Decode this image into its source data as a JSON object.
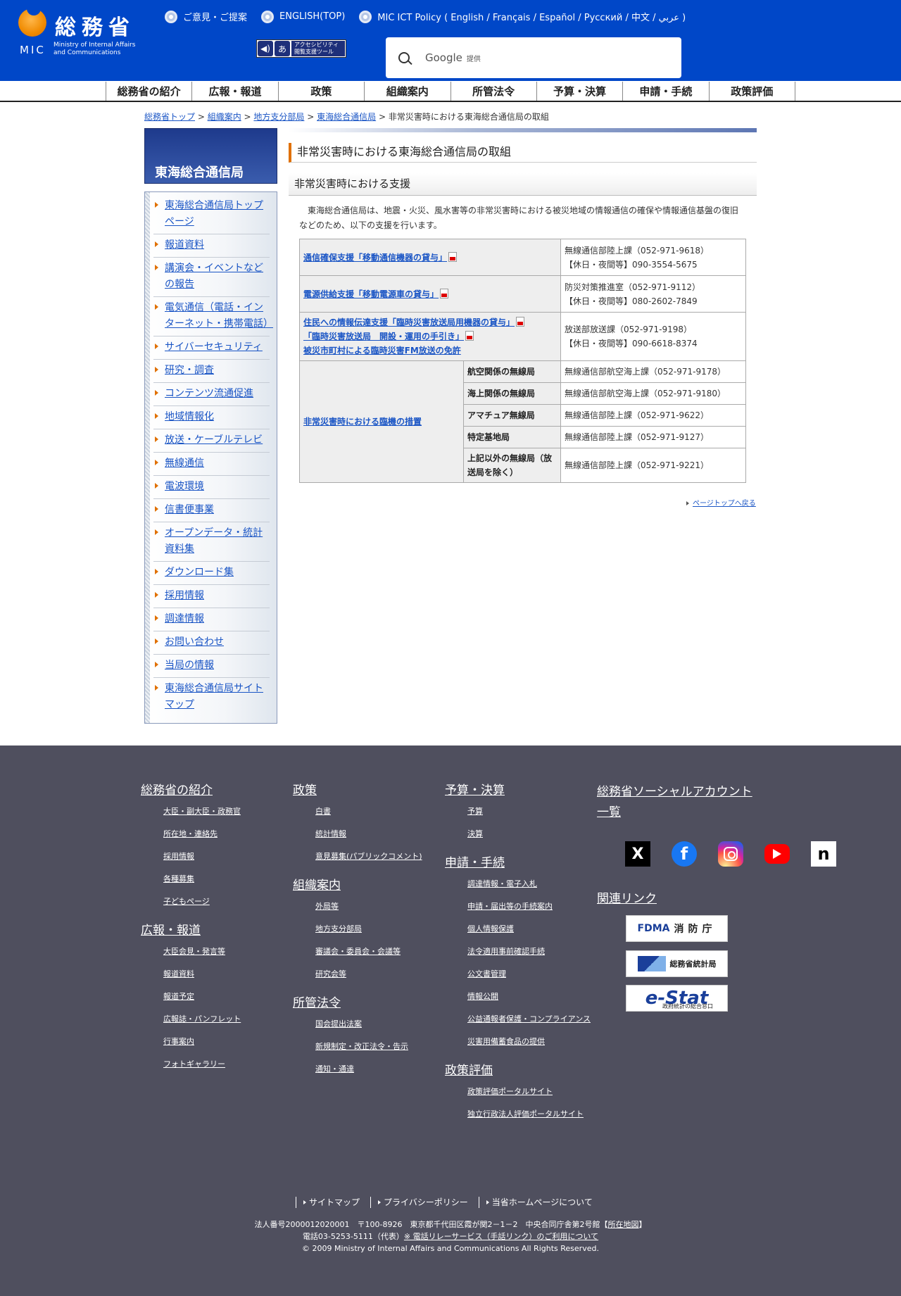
{
  "header": {
    "logo_jp": "総務省",
    "logo_mic": "MIC",
    "logo_en_1": "Ministry of Internal Affairs",
    "logo_en_2": "and Communications",
    "top_links": [
      "ご意見・ご提案",
      "ENGLISH(TOP)",
      "MIC ICT Policy ( English / Français / Español / Русский / 中文 / عربي )"
    ],
    "accessibility_label": "アクセシビリティ 閲覧支援ツール",
    "search_google": "Google",
    "search_provided": "提供"
  },
  "nav": [
    "総務省の紹介",
    "広報・報道",
    "政策",
    "組織案内",
    "所管法令",
    "予算・決算",
    "申請・手続",
    "政策評価"
  ],
  "breadcrumb": {
    "items": [
      "総務省トップ",
      "組織案内",
      "地方支分部局",
      "東海総合通信局"
    ],
    "current": "非常災害時における東海総合通信局の取組"
  },
  "sidebar": {
    "title": "東海総合通信局",
    "items": [
      "東海総合通信局トップページ",
      "報道資料",
      "講演会・イベントなどの報告",
      "電気通信（電話・インターネット・携帯電話）",
      "サイバーセキュリティ",
      "研究・調査",
      "コンテンツ流通促進",
      "地域情報化",
      "放送・ケーブルテレビ",
      "無線通信",
      "電波環境",
      "信書便事業",
      "オープンデータ・統計資料集",
      "ダウンロード集",
      "採用情報",
      "調達情報",
      "お問い合わせ",
      "当局の情報",
      "東海総合通信局サイトマップ"
    ]
  },
  "main": {
    "title": "非常災害時における東海総合通信局の取組",
    "subtitle": "非常災害時における支援",
    "intro": "東海総合通信局は、地震・火災、風水害等の非常災害時における被災地域の情報通信の確保や情報通信基盤の復旧などのため、以下の支援を行います。",
    "rows": [
      {
        "link": "通信確保支援「移動通信機器の貸与」",
        "contact1": "無線通信部陸上課（052-971-9618）",
        "contact2": "【休日・夜間等】090-3554-5675"
      },
      {
        "link": "電源供給支援「移動電源車の貸与」",
        "contact1": "防災対策推進室（052-971-9112）",
        "contact2": "【休日・夜間等】080-2602-7849"
      },
      {
        "link1": "住民への情報伝達支援「臨時災害放送局用機器の貸与」",
        "link2": "「臨時災害放送局　開設・運用の手引き」",
        "link3": "被災市町村による臨時災害FM放送の免許",
        "contact1": "放送部放送課（052-971-9198）",
        "contact2": "【休日・夜間等】090-6618-8374"
      }
    ],
    "special_link": "非常災害時における臨機の措置",
    "special_rows": [
      {
        "type": "航空関係の無線局",
        "contact": "無線通信部航空海上課（052-971-9178）"
      },
      {
        "type": "海上関係の無線局",
        "contact": "無線通信部航空海上課（052-971-9180）"
      },
      {
        "type": "アマチュア無線局",
        "contact": "無線通信部陸上課（052-971-9622）"
      },
      {
        "type": "特定基地局",
        "contact": "無線通信部陸上課（052-971-9127）"
      },
      {
        "type": "上記以外の無線局（放送局を除く）",
        "contact": "無線通信部陸上課（052-971-9221）"
      }
    ],
    "pagetop": "ページトップへ戻る"
  },
  "footer": {
    "col1": [
      {
        "head": "総務省の紹介",
        "links": [
          "大臣・副大臣・政務官",
          "所在地・連絡先",
          "採用情報",
          "各種募集",
          "子どもページ"
        ]
      },
      {
        "head": "広報・報道",
        "links": [
          "大臣会見・発言等",
          "報道資料",
          "報道予定",
          "広報誌・パンフレット",
          "行事案内",
          "フォトギャラリー"
        ]
      }
    ],
    "col2": [
      {
        "head": "政策",
        "links": [
          "白書",
          "統計情報",
          "意見募集(パブリックコメント)"
        ]
      },
      {
        "head": "組織案内",
        "links": [
          "外局等",
          "地方支分部局",
          "審議会・委員会・会議等",
          "研究会等"
        ]
      },
      {
        "head": "所管法令",
        "links": [
          "国会提出法案",
          "新規制定・改正法令・告示",
          "通知・通達"
        ]
      }
    ],
    "col3": [
      {
        "head": "予算・決算",
        "links": [
          "予算",
          "決算"
        ]
      },
      {
        "head": "申請・手続",
        "links": [
          "調達情報・電子入札",
          "申請・届出等の手続案内",
          "個人情報保護",
          "法令適用事前確認手続",
          "公文書管理",
          "情報公開",
          "公益通報者保護・コンプライアンス",
          "災害用備蓄食品の提供"
        ]
      },
      {
        "head": "政策評価",
        "links": [
          "政策評価ポータルサイト",
          "独立行政法人評価ポータルサイト"
        ]
      }
    ],
    "social_head": "総務省ソーシャルアカウント一覧",
    "related_head": "関連リンク",
    "related": {
      "fdma_mark": "FDMA",
      "fdma_name": "消防庁",
      "stat_name": "総務省統計局",
      "estat_name": "e-Stat",
      "estat_sub": "政府統計の総合窓口"
    },
    "bottom_links": [
      "サイトマップ",
      "プライバシーポリシー",
      "当省ホームページについて"
    ],
    "address": "法人番号2000012020001　〒100-8926　東京都千代田区霞が関2－1－2　中央合同庁舎第2号館【",
    "map_link": "所在地図",
    "address_end": "】",
    "phone": "電話03-5253-5111（代表）",
    "relay_link": "※ 電話リレーサービス（手話リンク）のご利用について",
    "copyright": "© 2009 Ministry of Internal Affairs and Communications All Rights Reserved."
  }
}
